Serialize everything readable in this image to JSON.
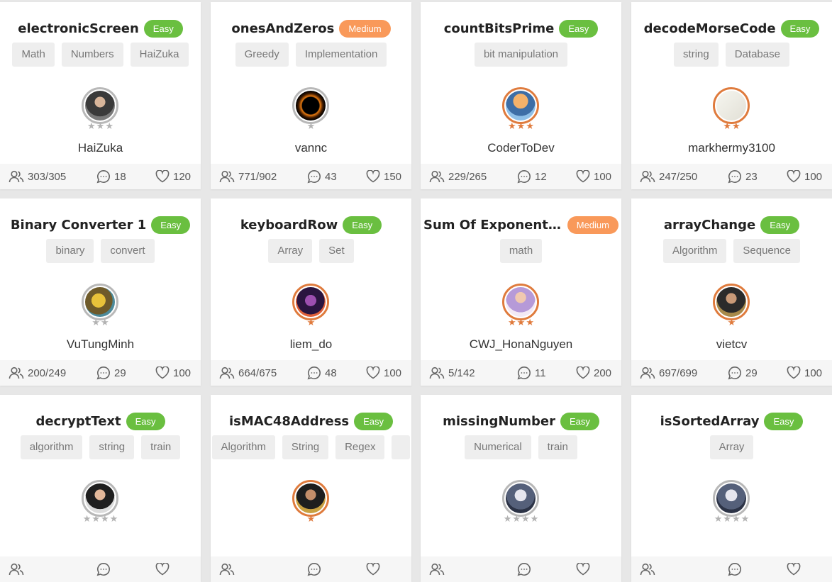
{
  "colors": {
    "easy": "#6abf40",
    "medium": "#f9995a",
    "silver_rank": "#b3b3b3",
    "bronze_rank": "#e07a3c"
  },
  "icons": {
    "users": "users-icon",
    "comments": "comment-icon",
    "likes": "heart-icon"
  },
  "cards": [
    {
      "title": "electronicScreen",
      "difficulty": "Easy",
      "tags": [
        "Math",
        "Numbers",
        "HaiZuka"
      ],
      "user": "HaiZuka",
      "rank": "silver",
      "stars": 3,
      "solved": "303/305",
      "comments": "18",
      "likes": "120"
    },
    {
      "title": "onesAndZeros",
      "difficulty": "Medium",
      "tags": [
        "Greedy",
        "Implementation"
      ],
      "user": "vannc",
      "rank": "silver",
      "stars": 1,
      "solved": "771/902",
      "comments": "43",
      "likes": "150"
    },
    {
      "title": "countBitsPrime",
      "difficulty": "Easy",
      "tags": [
        "bit manipulation"
      ],
      "user": "CoderToDev",
      "rank": "bronze",
      "stars": 3,
      "solved": "229/265",
      "comments": "12",
      "likes": "100"
    },
    {
      "title": "decodeMorseCode",
      "difficulty": "Easy",
      "tags": [
        "string",
        "Database"
      ],
      "user": "markhermy3100",
      "rank": "bronze",
      "stars": 2,
      "solved": "247/250",
      "comments": "23",
      "likes": "100"
    },
    {
      "title": "Binary Converter 1",
      "difficulty": "Easy",
      "tags": [
        "binary",
        "convert"
      ],
      "user": "VuTungMinh",
      "rank": "silver",
      "stars": 2,
      "solved": "200/249",
      "comments": "29",
      "likes": "100"
    },
    {
      "title": "keyboardRow",
      "difficulty": "Easy",
      "tags": [
        "Array",
        "Set"
      ],
      "user": "liem_do",
      "rank": "bronze",
      "stars": 1,
      "solved": "664/675",
      "comments": "48",
      "likes": "100"
    },
    {
      "title": "Sum Of Exponenti...",
      "difficulty": "Medium",
      "tags": [
        "math"
      ],
      "user": "CWJ_HonaNguyen",
      "rank": "bronze",
      "stars": 3,
      "solved": "5/142",
      "comments": "11",
      "likes": "200"
    },
    {
      "title": "arrayChange",
      "difficulty": "Easy",
      "tags": [
        "Algorithm",
        "Sequence"
      ],
      "user": "vietcv",
      "rank": "bronze",
      "stars": 1,
      "solved": "697/699",
      "comments": "29",
      "likes": "100"
    },
    {
      "title": "decryptText",
      "difficulty": "Easy",
      "tags": [
        "algorithm",
        "string",
        "train"
      ],
      "user": "",
      "rank": "silver",
      "stars": 4,
      "solved": "",
      "comments": "",
      "likes": ""
    },
    {
      "title": "isMAC48Address",
      "difficulty": "Easy",
      "tags": [
        "Algorithm",
        "String",
        "Regex",
        ""
      ],
      "user": "",
      "rank": "bronze",
      "stars": 1,
      "solved": "",
      "comments": "",
      "likes": ""
    },
    {
      "title": "missingNumber",
      "difficulty": "Easy",
      "tags": [
        "Numerical",
        "train"
      ],
      "user": "",
      "rank": "silver",
      "stars": 4,
      "solved": "",
      "comments": "",
      "likes": ""
    },
    {
      "title": "isSortedArray",
      "difficulty": "Easy",
      "tags": [
        "Array"
      ],
      "user": "",
      "rank": "silver",
      "stars": 4,
      "solved": "",
      "comments": "",
      "likes": ""
    }
  ]
}
